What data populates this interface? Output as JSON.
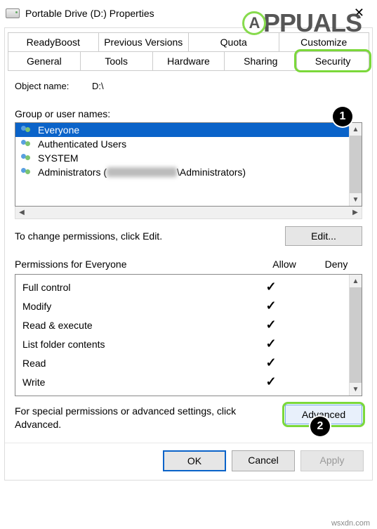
{
  "window": {
    "title": "Portable Drive (D:) Properties"
  },
  "tabs": {
    "row1": [
      "ReadyBoost",
      "Previous Versions",
      "Quota",
      "Customize"
    ],
    "row2": [
      "General",
      "Tools",
      "Hardware",
      "Sharing",
      "Security"
    ],
    "active": "Security"
  },
  "object": {
    "label": "Object name:",
    "value": "D:\\"
  },
  "groups": {
    "label": "Group or user names:",
    "items": [
      {
        "name": "Everyone",
        "selected": true
      },
      {
        "name": "Authenticated Users",
        "selected": false
      },
      {
        "name": "SYSTEM",
        "selected": false
      },
      {
        "name": "Administrators (",
        "redacted": true,
        "suffix": "\\Administrators)",
        "selected": false
      }
    ]
  },
  "edit": {
    "hint": "To change permissions, click Edit.",
    "button": "Edit..."
  },
  "permissions": {
    "header": {
      "title": "Permissions for Everyone",
      "allow": "Allow",
      "deny": "Deny"
    },
    "rows": [
      {
        "name": "Full control",
        "allow": true,
        "deny": false
      },
      {
        "name": "Modify",
        "allow": true,
        "deny": false
      },
      {
        "name": "Read & execute",
        "allow": true,
        "deny": false
      },
      {
        "name": "List folder contents",
        "allow": true,
        "deny": false
      },
      {
        "name": "Read",
        "allow": true,
        "deny": false
      },
      {
        "name": "Write",
        "allow": true,
        "deny": false
      }
    ]
  },
  "advanced": {
    "hint": "For special permissions or advanced settings, click Advanced.",
    "button": "Advanced"
  },
  "dialog_buttons": {
    "ok": "OK",
    "cancel": "Cancel",
    "apply": "Apply"
  },
  "annotations": {
    "badge1": "1",
    "badge2": "2",
    "logo_text": "PPUALS",
    "site": "wsxdn.com"
  }
}
